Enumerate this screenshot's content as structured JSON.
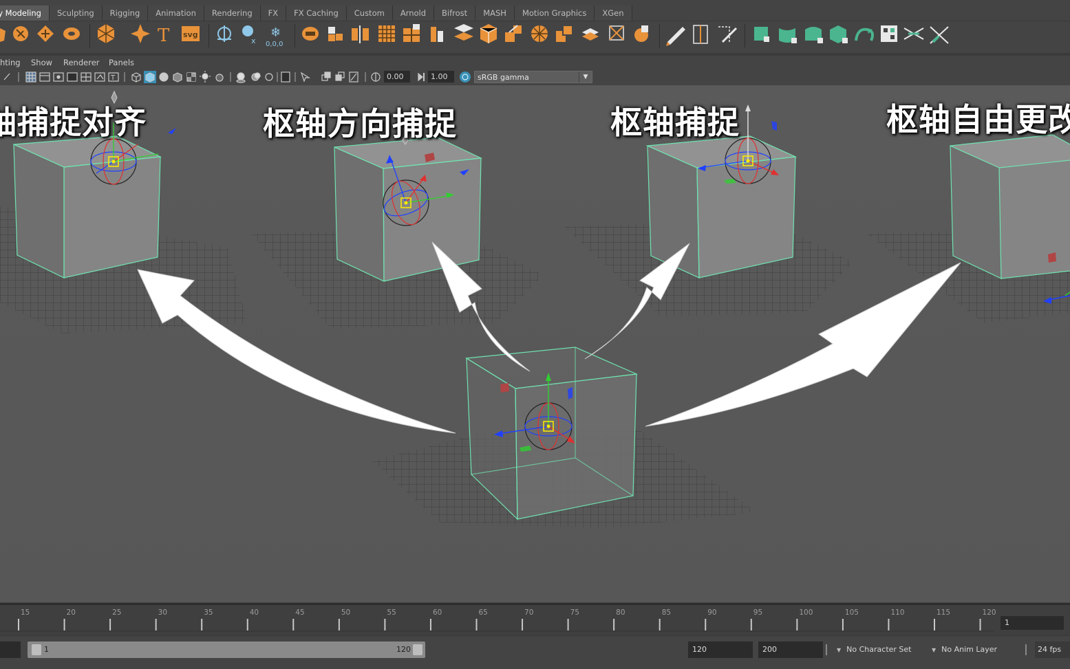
{
  "shelf": {
    "tabs": [
      "ly Modeling",
      "Sculpting",
      "Rigging",
      "Animation",
      "Rendering",
      "FX",
      "FX Caching",
      "Custom",
      "Arnold",
      "Bifrost",
      "MASH",
      "Motion Graphics",
      "XGen"
    ],
    "active_tab": 0,
    "svg_icon_text": "svg"
  },
  "panel_menu": {
    "items": [
      "hting",
      "Show",
      "Renderer",
      "Panels"
    ]
  },
  "panel_toolbar": {
    "exposure": "0.00",
    "gamma": "1.00",
    "color_space": "sRGB gamma"
  },
  "viewport": {
    "labels": [
      "轴捕捉对齐",
      "枢轴方向捕捉",
      "枢轴捕捉",
      "枢轴自由更改"
    ]
  },
  "timeline": {
    "ticks": [
      "15",
      "20",
      "25",
      "30",
      "35",
      "40",
      "45",
      "50",
      "55",
      "60",
      "65",
      "70",
      "75",
      "80",
      "85",
      "90",
      "95",
      "100",
      "105",
      "110",
      "115",
      "120"
    ],
    "current_frame": "1"
  },
  "range": {
    "start_handle_text": "1",
    "end_handle_text": "120",
    "playback_end": "120",
    "anim_end": "200",
    "character_set": "No Character Set",
    "anim_layer": "No Anim Layer",
    "fps": "24 fps"
  },
  "colors": {
    "wire": "#6fe3b0",
    "axis_x": "#e03030",
    "axis_y": "#30d030",
    "axis_z": "#2040ff",
    "shelf_orange": "#e8923a",
    "shelf_green": "#4ab58e",
    "pivot": "#ffee00"
  }
}
